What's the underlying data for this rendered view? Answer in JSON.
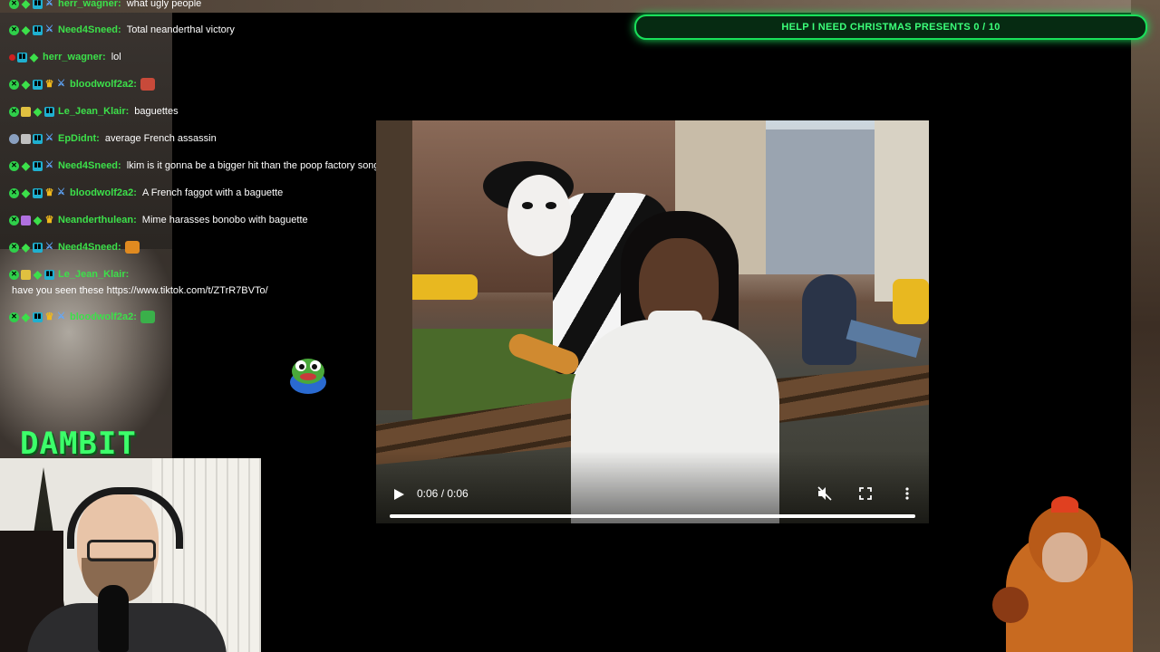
{
  "goal": {
    "label": "HELP I NEED CHRISTMAS PRESENTS 0 / 10"
  },
  "chat": [
    {
      "user": "herr_wagner:",
      "message": "what ugly people"
    },
    {
      "user": "Need4Sneed:",
      "message": "Total neanderthal victory"
    },
    {
      "user": "herr_wagner:",
      "message": "lol"
    },
    {
      "user": "bloodwolf2a2:",
      "message": ""
    },
    {
      "user": "Le_Jean_Klair:",
      "message": "baguettes"
    },
    {
      "user": "EpDidnt:",
      "message": "average French assassin"
    },
    {
      "user": "Need4Sneed:",
      "message": "lkim is it gonna be a bigger hit than the poop factory song?"
    },
    {
      "user": "bloodwolf2a2:",
      "message": "A French faggot with a baguette"
    },
    {
      "user": "Neanderthulean:",
      "message": "Mime harasses bonobo with baguette"
    },
    {
      "user": "Need4Sneed:",
      "message": ""
    },
    {
      "user": "Le_Jean_Klair:",
      "message": ""
    },
    {
      "user": "bloodwolf2a2:",
      "message": ""
    }
  ],
  "chat_wrap": "have you seen these https://www.tiktok.com/t/ZTrR7BVTo/",
  "logo": "DAMBIT",
  "video": {
    "time": "0:06 / 0:06",
    "progress_fraction": 1.0
  },
  "icons": {
    "play": "play-icon",
    "mute": "muted-speaker-icon",
    "fullscreen": "fullscreen-icon",
    "more": "more-vertical-icon"
  },
  "colors": {
    "accent_green": "#3ce04a",
    "goal_border": "#19e05a"
  }
}
